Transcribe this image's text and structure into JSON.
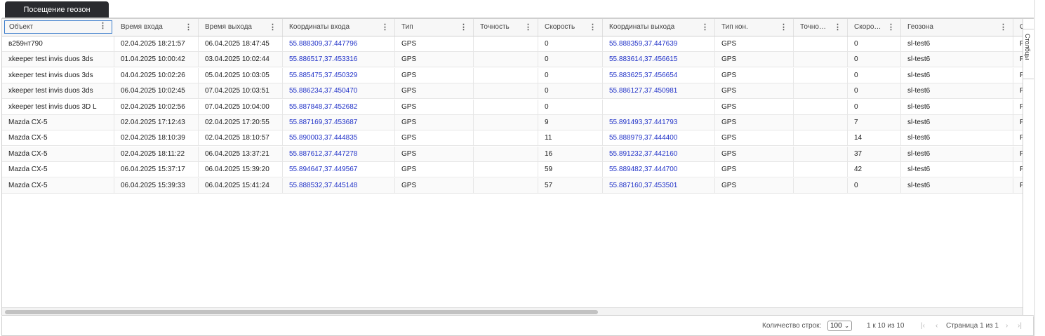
{
  "tab": {
    "label": "Посещение геозон"
  },
  "columns": [
    {
      "label": "Объект",
      "has_menu": true
    },
    {
      "label": "Время входа",
      "has_menu": true
    },
    {
      "label": "Время выхода",
      "has_menu": true
    },
    {
      "label": "Координаты входа",
      "has_menu": true
    },
    {
      "label": "Тип",
      "has_menu": true
    },
    {
      "label": "Точность",
      "has_menu": true
    },
    {
      "label": "Скорость",
      "has_menu": true
    },
    {
      "label": "Координаты выхода",
      "has_menu": true
    },
    {
      "label": "Тип кон.",
      "has_menu": true
    },
    {
      "label": "Точно…",
      "has_menu": true
    },
    {
      "label": "Скоро…",
      "has_menu": true
    },
    {
      "label": "Геозона",
      "has_menu": true
    },
    {
      "label": "С",
      "has_menu": false
    }
  ],
  "rows": [
    [
      "в259нт790",
      "02.04.2025 18:21:57",
      "06.04.2025 18:47:45",
      "55.888309,37.447796",
      "GPS",
      "",
      "0",
      "55.888359,37.447639",
      "GPS",
      "",
      "0",
      "sl-test6",
      "P"
    ],
    [
      "xkeeper test invis duos 3ds",
      "01.04.2025 10:00:42",
      "03.04.2025 10:02:44",
      "55.886517,37.453316",
      "GPS",
      "",
      "0",
      "55.883614,37.456615",
      "GPS",
      "",
      "0",
      "sl-test6",
      "P"
    ],
    [
      "xkeeper test invis duos 3ds",
      "04.04.2025 10:02:26",
      "05.04.2025 10:03:05",
      "55.885475,37.450329",
      "GPS",
      "",
      "0",
      "55.883625,37.456654",
      "GPS",
      "",
      "0",
      "sl-test6",
      "P"
    ],
    [
      "xkeeper test invis duos 3ds",
      "06.04.2025 10:02:45",
      "07.04.2025 10:03:51",
      "55.886234,37.450470",
      "GPS",
      "",
      "0",
      "55.886127,37.450981",
      "GPS",
      "",
      "0",
      "sl-test6",
      "P"
    ],
    [
      "xkeeper test invis duos 3D L",
      "02.04.2025 10:02:56",
      "07.04.2025 10:04:00",
      "55.887848,37.452682",
      "GPS",
      "",
      "0",
      "",
      "GPS",
      "",
      "0",
      "sl-test6",
      "P"
    ],
    [
      "Mazda CX-5",
      "02.04.2025 17:12:43",
      "02.04.2025 17:20:55",
      "55.887169,37.453687",
      "GPS",
      "",
      "9",
      "55.891493,37.441793",
      "GPS",
      "",
      "7",
      "sl-test6",
      "P"
    ],
    [
      "Mazda CX-5",
      "02.04.2025 18:10:39",
      "02.04.2025 18:10:57",
      "55.890003,37.444835",
      "GPS",
      "",
      "11",
      "55.888979,37.444400",
      "GPS",
      "",
      "14",
      "sl-test6",
      "P"
    ],
    [
      "Mazda CX-5",
      "02.04.2025 18:11:22",
      "06.04.2025 13:37:21",
      "55.887612,37.447278",
      "GPS",
      "",
      "16",
      "55.891232,37.442160",
      "GPS",
      "",
      "37",
      "sl-test6",
      "P"
    ],
    [
      "Mazda CX-5",
      "06.04.2025 15:37:17",
      "06.04.2025 15:39:20",
      "55.894647,37.449567",
      "GPS",
      "",
      "59",
      "55.889482,37.444700",
      "GPS",
      "",
      "42",
      "sl-test6",
      "P"
    ],
    [
      "Mazda CX-5",
      "06.04.2025 15:39:33",
      "06.04.2025 15:41:24",
      "55.888532,37.445148",
      "GPS",
      "",
      "57",
      "55.887160,37.453501",
      "GPS",
      "",
      "0",
      "sl-test6",
      "P"
    ]
  ],
  "side_panel": {
    "label": "Столбцы",
    "icon": "columns-icon"
  },
  "footer": {
    "rows_label": "Количество строк:",
    "rows_value": "100",
    "range": "1 к 10 из 10",
    "page_text": "Страница 1 из 1"
  },
  "colors": {
    "link": "#2233c8",
    "tab_bg": "#2a2b2f",
    "focus": "#3d7ecc"
  }
}
